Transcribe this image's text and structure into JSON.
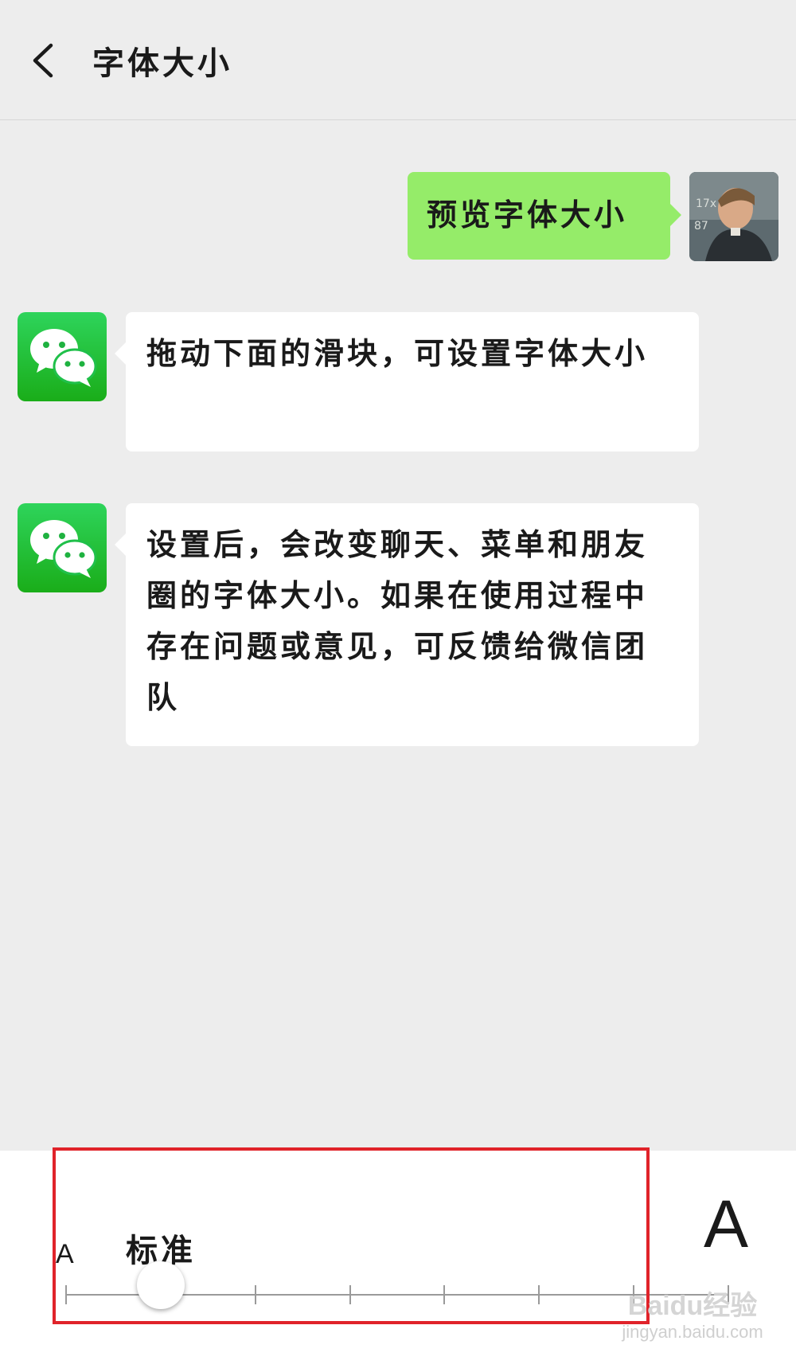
{
  "header": {
    "title": "字体大小",
    "back_icon": "chevron-left-icon"
  },
  "chat": {
    "sent_message": "预览字体大小",
    "received_messages": [
      "拖动下面的滑块，可设置字体大小",
      "设置后，会改变聊天、菜单和朋友圈的字体大小。如果在使用过程中存在问题或意见，可反馈给微信团队"
    ]
  },
  "font_size_panel": {
    "small_label": "A",
    "large_label": "A",
    "current_level": "标准",
    "steps": 8,
    "selected_step": 2
  },
  "watermark": {
    "brand": "Baidu经验",
    "url": "jingyan.baidu.com"
  },
  "colors": {
    "sent_bubble": "#95ec69",
    "received_bubble": "#ffffff",
    "background": "#ededed",
    "highlight": "#e0232a",
    "wechat_green": "#1aad19"
  }
}
